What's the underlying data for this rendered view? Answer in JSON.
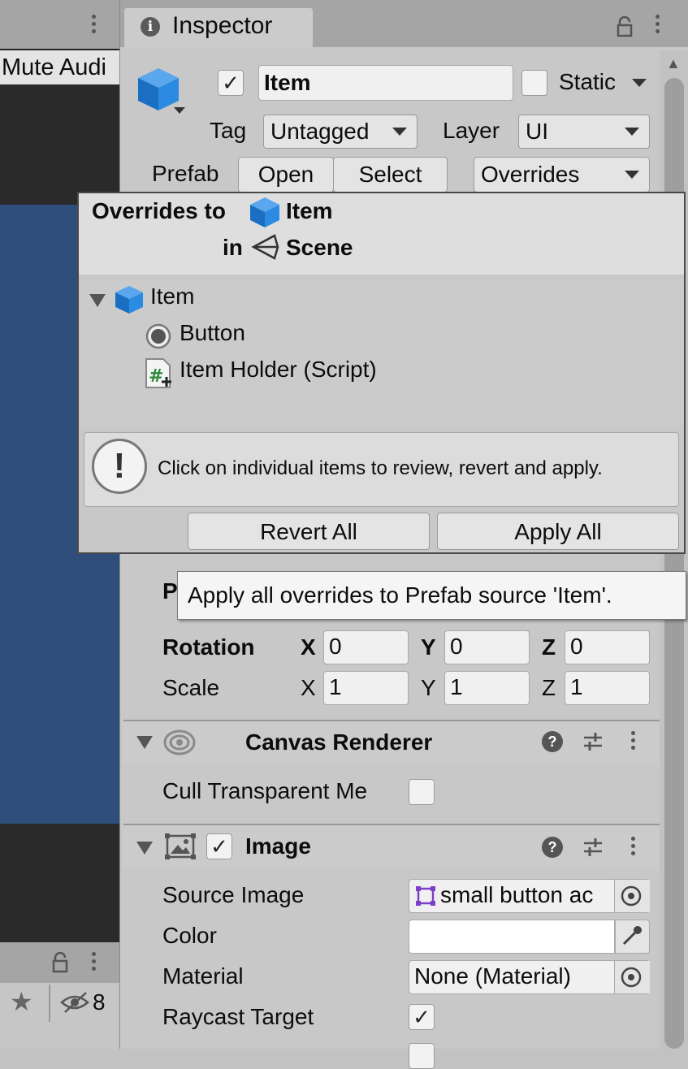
{
  "left_panel": {
    "mute_audio_label": "Mute Audi",
    "toolbar_count": "8"
  },
  "inspector": {
    "tab_label": "Inspector",
    "object": {
      "active": true,
      "name": "Item",
      "static_label": "Static",
      "static_checked": false,
      "tag_label": "Tag",
      "tag_value": "Untagged",
      "layer_label": "Layer",
      "layer_value": "UI",
      "prefab_label": "Prefab",
      "open_label": "Open",
      "select_label": "Select",
      "overrides_label": "Overrides"
    },
    "transform": {
      "partial_label": "P",
      "rotation_label": "Rotation",
      "scale_label": "Scale",
      "axis_x": "X",
      "axis_y": "Y",
      "axis_z": "Z",
      "rotation": {
        "x": "0",
        "y": "0",
        "z": "0"
      },
      "scale": {
        "x": "1",
        "y": "1",
        "z": "1"
      }
    },
    "canvas_renderer": {
      "title": "Canvas Renderer",
      "cull_label": "Cull Transparent Me",
      "cull_checked": false
    },
    "image": {
      "title": "Image",
      "enabled": true,
      "source_image_label": "Source Image",
      "source_image_value": "small button ac",
      "color_label": "Color",
      "color_value": "#ffffff",
      "material_label": "Material",
      "material_value": "None (Material)",
      "raycast_label": "Raycast Target",
      "raycast_checked": true
    }
  },
  "overrides_popup": {
    "title_prefix": "Overrides to",
    "title_object": "Item",
    "in_label": "in",
    "scene_label": "Scene",
    "tree": {
      "root": "Item",
      "children": [
        "Button",
        "Item Holder (Script)"
      ]
    },
    "help_text": "Click on individual items to review, revert and apply.",
    "revert_all_label": "Revert All",
    "apply_all_label": "Apply All"
  },
  "tooltip": {
    "text": "Apply all overrides to Prefab source 'Item'."
  },
  "colors": {
    "scene_blue": "#304e7c",
    "cube_blue": "#1e7fd9",
    "panel_gray": "#c8c8c8"
  },
  "icons": [
    "info-icon",
    "lock-icon",
    "kebab-icon",
    "cube-icon",
    "unity-scene-icon",
    "radio-icon",
    "script-icon",
    "warning-icon",
    "eye-icon",
    "help-icon",
    "sliders-icon",
    "image-icon",
    "sprite-icon",
    "target-icon",
    "eyedropper-icon",
    "star-icon",
    "hidden-eye-icon",
    "checkmark-icon",
    "foldout-arrow-icon"
  ]
}
